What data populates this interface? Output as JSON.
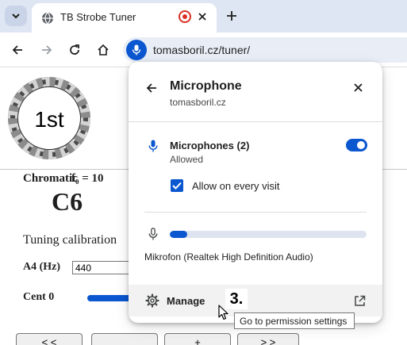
{
  "browser": {
    "tab_title": "TB Strobe Tuner",
    "url": "tomasboril.cz/tuner/"
  },
  "page": {
    "strobe_label": "1st",
    "mode_label": "Chromatic",
    "frequency_label": "f₀ = 10",
    "note": "C6",
    "calibration_heading": "Tuning calibration",
    "a4_label": "A4 (Hz)",
    "a4_value": "440",
    "cent_label": "Cent 0",
    "buttons": [
      "< <",
      "",
      "+",
      "> >"
    ]
  },
  "popup": {
    "title": "Microphone",
    "site": "tomasboril.cz",
    "permission_title": "Microphones (2)",
    "permission_state": "Allowed",
    "toggle_on": true,
    "checkbox_label": "Allow on every visit",
    "checkbox_checked": true,
    "mic_level": 0.09,
    "device_name": "Mikrofon (Realtek High Definition Audio)",
    "manage_label": "Manage"
  },
  "overlay": {
    "step_label": "3.",
    "tooltip": "Go to permission settings"
  },
  "colors": {
    "accent": "#0b57d0",
    "tabstrip": "#dfe6f3",
    "omnibox": "#e9eef6",
    "record_red": "#d93025"
  }
}
